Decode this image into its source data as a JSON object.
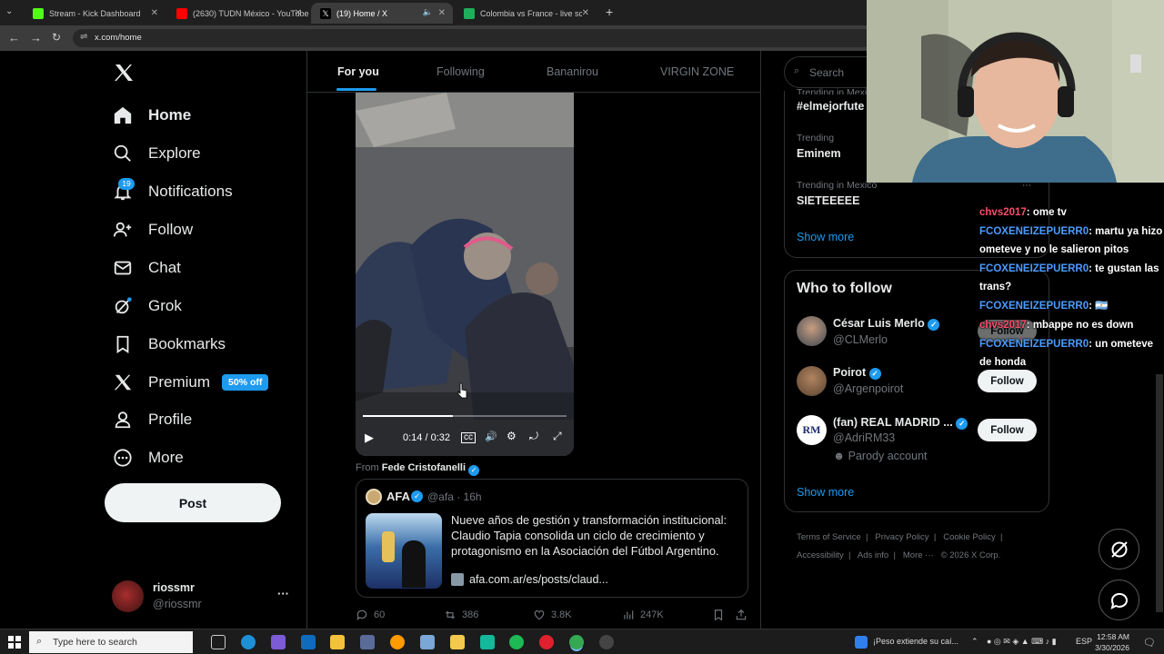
{
  "browser": {
    "tabs": [
      {
        "title": "Stream - Kick Dashboard",
        "color": "#53fc18"
      },
      {
        "title": "(2630) TUDN México - YouTube",
        "color": "#ff0000"
      },
      {
        "title": "(19) Home / X",
        "color": "#ffffff"
      },
      {
        "title": "Colombia vs France - live score",
        "color": "#1fae5b"
      }
    ],
    "new_tab": "+",
    "url": "x.com/home"
  },
  "sidebar": {
    "items": [
      {
        "label": "Home",
        "icon": "home-icon"
      },
      {
        "label": "Explore",
        "icon": "search-icon"
      },
      {
        "label": "Notifications",
        "icon": "bell-icon",
        "badge": "19"
      },
      {
        "label": "Follow",
        "icon": "person-plus-icon"
      },
      {
        "label": "Chat",
        "icon": "mail-icon"
      },
      {
        "label": "Grok",
        "icon": "grok-icon"
      },
      {
        "label": "Bookmarks",
        "icon": "bookmark-icon"
      },
      {
        "label": "Premium",
        "icon": "x-logo-icon",
        "badge": "50% off"
      },
      {
        "label": "Profile",
        "icon": "person-icon"
      },
      {
        "label": "More",
        "icon": "more-circle-icon"
      }
    ],
    "post": "Post",
    "account": {
      "name": "riossmr",
      "handle": "@riossmr",
      "more": "···"
    }
  },
  "feed": {
    "tabs": [
      "For you",
      "Following",
      "Bananirou",
      "VIRGIN ZONE"
    ],
    "video": {
      "time": "0:14 / 0:32",
      "progress": 0.44
    },
    "from_label": "From",
    "from_name": "Fede Cristofanelli",
    "card": {
      "name": "AFA",
      "handle": "@afa",
      "age": "· 16h",
      "text": "Nueve años de gestión y transformación institucional: Claudio Tapia consolida un ciclo de crecimiento y protagonismo en la Asociación del Fútbol Argentino.",
      "link": "afa.com.ar/es/posts/claud..."
    },
    "actions": {
      "replies": "60",
      "reposts": "386",
      "likes": "3.8K",
      "views": "247K"
    }
  },
  "right": {
    "search_placeholder": "Search",
    "trends": [
      {
        "context": "Trending in Mexico",
        "name": "#elmejorfute"
      },
      {
        "context": "Trending",
        "name": "Eminem"
      },
      {
        "context": "Trending in Mexico",
        "name": "SIETEEEEE"
      }
    ],
    "show_more": "Show more",
    "who_title": "Who to follow",
    "who": [
      {
        "name": "César Luis Merlo",
        "handle": "@CLMerlo",
        "follow": "Follow"
      },
      {
        "name": "Poirot",
        "handle": "@Argenpoirot",
        "follow": "Follow"
      },
      {
        "name": "(fan) REAL MADRID ...",
        "handle": "@AdriRM33",
        "note": "Parody account",
        "follow": "Follow"
      }
    ],
    "footer": [
      "Terms of Service",
      "Privacy Policy",
      "Cookie Policy",
      "Accessibility",
      "Ads info",
      "More ···",
      "© 2026 X Corp."
    ]
  },
  "stream_chat": [
    {
      "user": "chvs2017",
      "msg": ": ome tv",
      "color": "red"
    },
    {
      "user": "FCOXENEIZEPUERR0",
      "msg": ": martu ya hizo ometeve y no le salieron pitos",
      "color": "blue"
    },
    {
      "user": "FCOXENEIZEPUERR0",
      "msg": ": te gustan las trans?",
      "color": "blue"
    },
    {
      "user": "FCOXENEIZEPUERR0",
      "msg": ": 🇦🇷",
      "color": "blue"
    },
    {
      "user": "chvs2017",
      "msg": ": mbappe no es down",
      "color": "red"
    },
    {
      "user": "FCOXENEIZEPUERR0",
      "msg": ": un ometeve de honda",
      "color": "blue"
    }
  ],
  "taskbar": {
    "search": "Type here to search",
    "notification": "¡Peso extiende su caí...",
    "lang": "ESP",
    "time": "12:58 AM",
    "date": "3/30/2026"
  }
}
